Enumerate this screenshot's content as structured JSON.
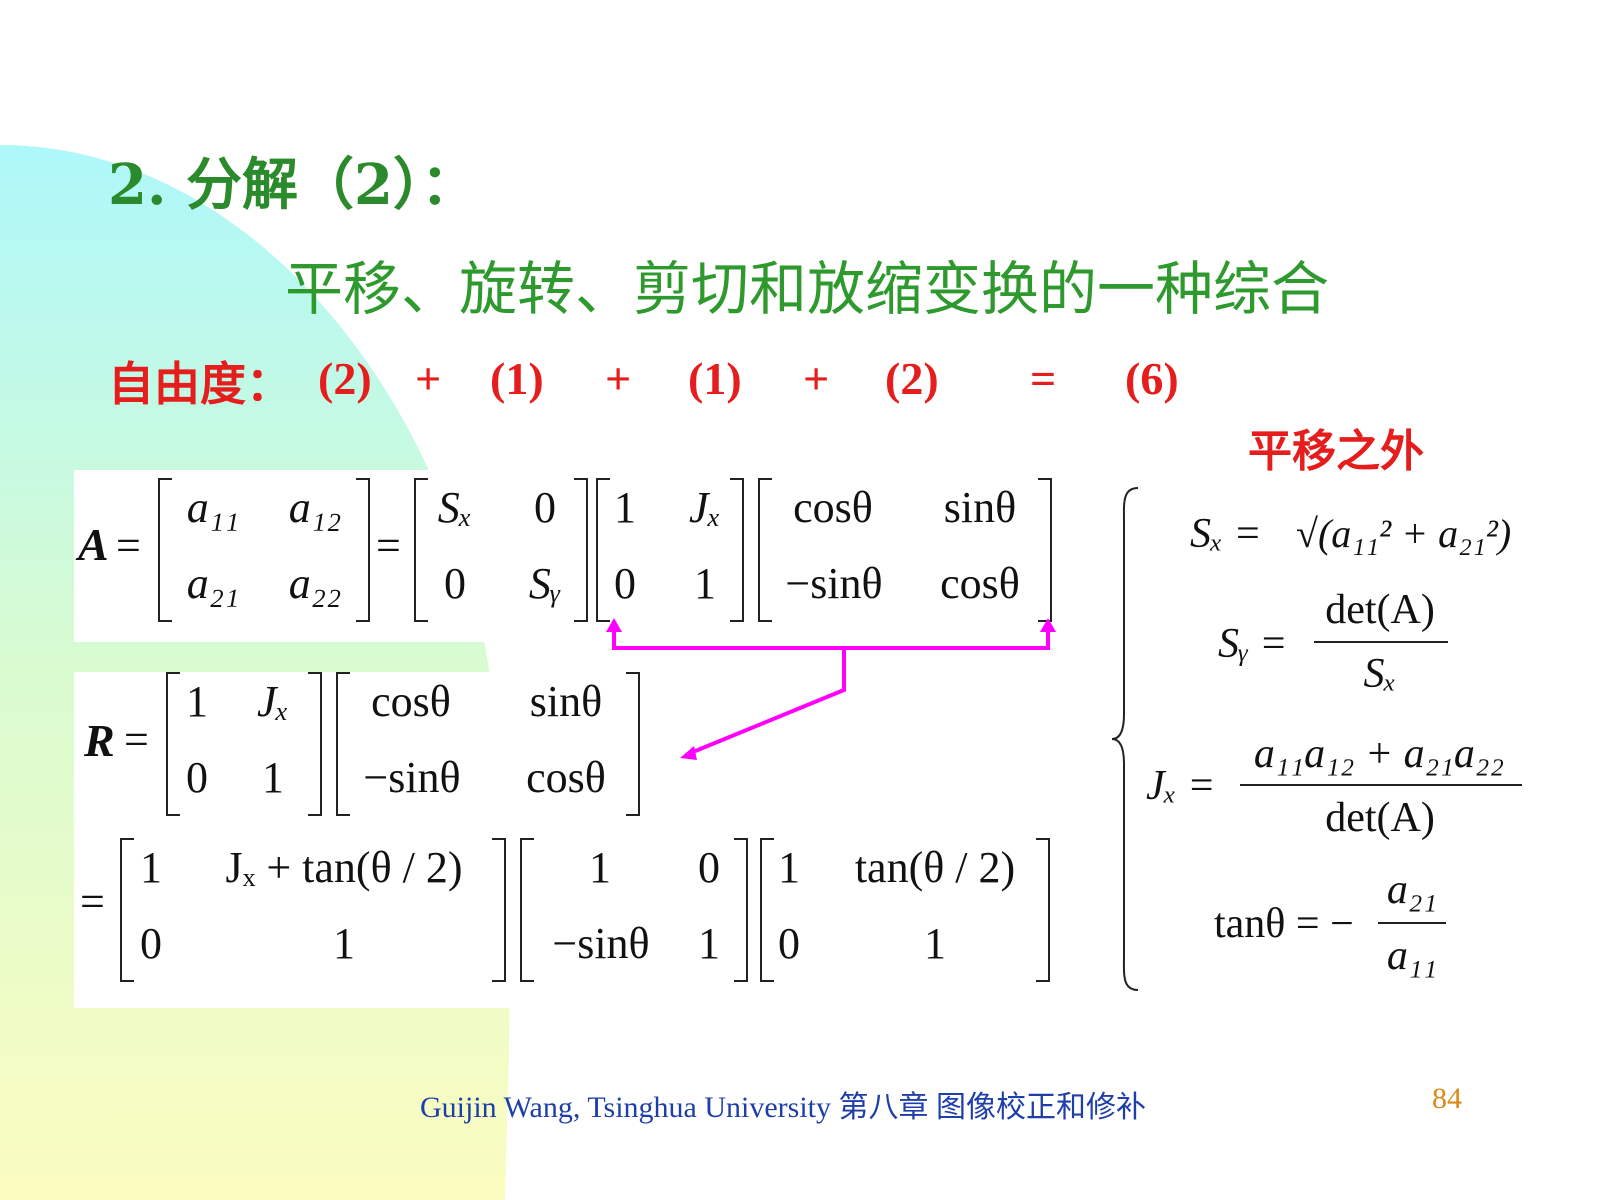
{
  "slide": {
    "heading": "2. 分解（2）：",
    "subtitle": "平移、旋转、剪切和放缩变换的一种综合",
    "dof": {
      "label": "自由度：",
      "items": [
        "(2)",
        "+",
        "(1)",
        "+",
        "(1)",
        "+",
        "(2)",
        "=",
        "(6)"
      ]
    },
    "note": "平移之外",
    "footer": {
      "text": "Guijin Wang, Tsinghua University 第八章  图像校正和修补",
      "page": "84"
    }
  },
  "colors": {
    "heading": "#2b8a2b",
    "accent_red": "#e51d1d",
    "arrow": "#ff00ff",
    "footer": "#1f3fa8",
    "page_number": "#d98a16",
    "bg_cyan": "#aef8fa",
    "bg_green": "#d9fbd0",
    "bg_yellow": "#fbfcc0"
  },
  "equations": {
    "A_symbol": "A",
    "R_symbol": "R",
    "eq": "=",
    "A_matrix": [
      "a₁₁",
      "a₁₂",
      "a₂₁",
      "a₂₂"
    ],
    "S_matrix": [
      "Sₓ",
      "0",
      "0",
      "Sᵧ"
    ],
    "J_matrix": [
      "1",
      "Jₓ",
      "0",
      "1"
    ],
    "Rot_matrix": [
      "cosθ",
      "sinθ",
      "−sinθ",
      "cosθ"
    ],
    "R_shear": [
      "1",
      "Jₓ",
      "0",
      "1"
    ],
    "R_rot": [
      "cosθ",
      "sinθ",
      "−sinθ",
      "cosθ"
    ],
    "D1": [
      "1",
      "Jₓ + tan(θ / 2)",
      "0",
      "1"
    ],
    "D2": [
      "1",
      "0",
      "−sinθ",
      "1"
    ],
    "D3": [
      "1",
      "tan(θ / 2)",
      "0",
      "1"
    ],
    "params": {
      "sx_lhs": "Sₓ =",
      "sx_rhs": "√(a₁₁² + a₂₁²)",
      "sy_lhs": "Sᵧ =",
      "sy_num": "det(A)",
      "sy_den": "Sₓ",
      "jx_lhs": "Jₓ =",
      "jx_num": "a₁₁a₁₂ + a₂₁a₂₂",
      "jx_den": "det(A)",
      "tan_lhs": "tanθ = −",
      "tan_num": "a₂₁",
      "tan_den": "a₁₁"
    }
  }
}
